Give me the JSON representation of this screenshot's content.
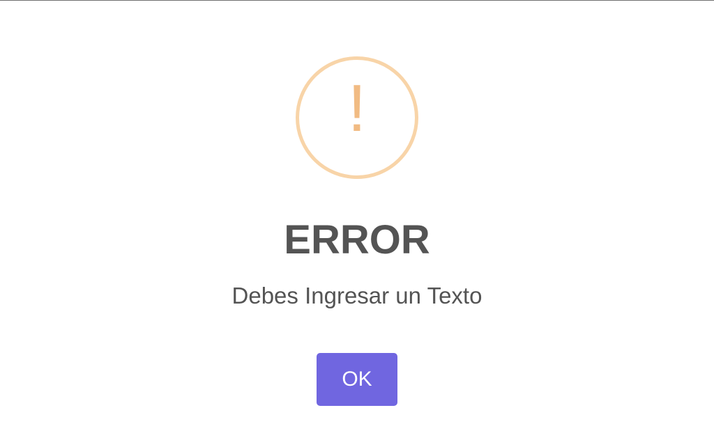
{
  "dialog": {
    "icon": "warning-icon",
    "icon_glyph": "!",
    "icon_color": "#f1bb83",
    "icon_ring_color": "#f8d4a8",
    "title": "ERROR",
    "message": "Debes Ingresar un Texto",
    "confirm_label": "OK",
    "confirm_color": "#7066e0"
  }
}
